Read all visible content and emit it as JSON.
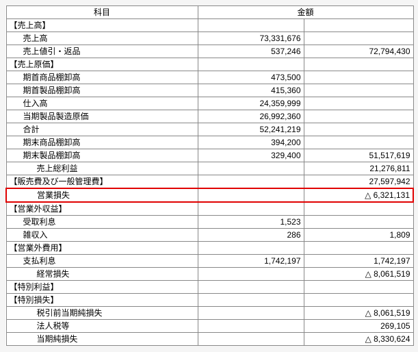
{
  "headers": {
    "item": "科目",
    "amount": "金額"
  },
  "rows": [
    {
      "label": "【売上高】",
      "indent": 0,
      "v1": "",
      "v2": ""
    },
    {
      "label": "売上高",
      "indent": 1,
      "v1": "73,331,676",
      "v2": ""
    },
    {
      "label": "売上値引・返品",
      "indent": 1,
      "v1": "537,246",
      "v2": "72,794,430"
    },
    {
      "label": "【売上原価】",
      "indent": 0,
      "v1": "",
      "v2": ""
    },
    {
      "label": "期首商品棚卸高",
      "indent": 1,
      "v1": "473,500",
      "v2": ""
    },
    {
      "label": "期首製品棚卸高",
      "indent": 1,
      "v1": "415,360",
      "v2": ""
    },
    {
      "label": "仕入高",
      "indent": 1,
      "v1": "24,359,999",
      "v2": ""
    },
    {
      "label": "当期製品製造原価",
      "indent": 1,
      "v1": "26,992,360",
      "v2": ""
    },
    {
      "label": "合計",
      "indent": 1,
      "v1": "52,241,219",
      "v2": ""
    },
    {
      "label": "期末商品棚卸高",
      "indent": 1,
      "v1": "394,200",
      "v2": ""
    },
    {
      "label": "期末製品棚卸高",
      "indent": 1,
      "v1": "329,400",
      "v2": "51,517,619"
    },
    {
      "label": "売上総利益",
      "indent": 2,
      "v1": "",
      "v2": "21,276,811"
    },
    {
      "label": "【販売費及び一般管理費】",
      "indent": 0,
      "v1": "",
      "v2": "27,597,942"
    },
    {
      "label": "営業損失",
      "indent": 2,
      "v1": "",
      "v2": "△ 6,321,131",
      "hl": true
    },
    {
      "label": "【営業外収益】",
      "indent": 0,
      "v1": "",
      "v2": ""
    },
    {
      "label": "受取利息",
      "indent": 1,
      "v1": "1,523",
      "v2": ""
    },
    {
      "label": "雑収入",
      "indent": 1,
      "v1": "286",
      "v2": "1,809"
    },
    {
      "label": "【営業外費用】",
      "indent": 0,
      "v1": "",
      "v2": ""
    },
    {
      "label": "支払利息",
      "indent": 1,
      "v1": "1,742,197",
      "v2": "1,742,197"
    },
    {
      "label": "経常損失",
      "indent": 2,
      "v1": "",
      "v2": "△ 8,061,519"
    },
    {
      "label": "【特別利益】",
      "indent": 0,
      "v1": "",
      "v2": ""
    },
    {
      "label": "【特別損失】",
      "indent": 0,
      "v1": "",
      "v2": ""
    },
    {
      "label": "税引前当期純損失",
      "indent": 2,
      "v1": "",
      "v2": "△ 8,061,519"
    },
    {
      "label": "法人税等",
      "indent": 2,
      "v1": "",
      "v2": "269,105"
    },
    {
      "label": "当期純損失",
      "indent": 2,
      "v1": "",
      "v2": "△ 8,330,624"
    }
  ]
}
